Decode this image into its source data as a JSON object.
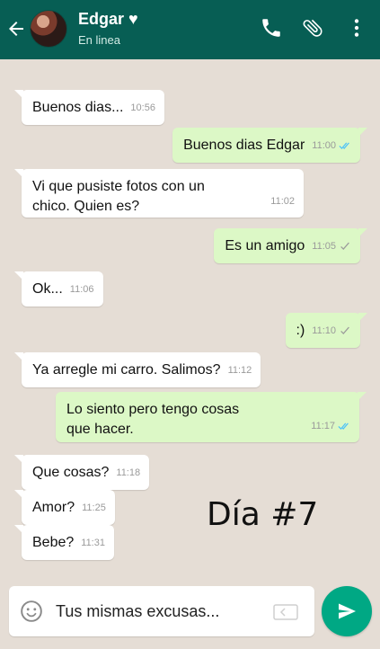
{
  "header": {
    "contact_name": "Edgar ♥",
    "status": "En linea"
  },
  "messages": [
    {
      "dir": "in",
      "text": "Buenos dias...",
      "time": "10:56",
      "tick": "none"
    },
    {
      "dir": "out",
      "text": "Buenos dias Edgar",
      "time": "11:00",
      "tick": "read"
    },
    {
      "dir": "in",
      "text": "Vi que pusiste fotos con un\nchico. Quien es?",
      "time": "11:02",
      "tick": "none"
    },
    {
      "dir": "out",
      "text": "Es un amigo",
      "time": "11:05",
      "tick": "sent"
    },
    {
      "dir": "in",
      "text": "Ok...",
      "time": "11:06",
      "tick": "none"
    },
    {
      "dir": "out",
      "text": ":)",
      "time": "11:10",
      "tick": "sent"
    },
    {
      "dir": "in",
      "text": "Ya arregle mi carro. Salimos?",
      "time": "11:12",
      "tick": "none"
    },
    {
      "dir": "out",
      "text": "Lo siento pero tengo cosas\nque hacer.",
      "time": "11:17",
      "tick": "read"
    },
    {
      "dir": "in",
      "text": "Que cosas?",
      "time": "11:18",
      "tick": "none"
    },
    {
      "dir": "in",
      "text": "Amor?",
      "time": "11:25",
      "tick": "none"
    },
    {
      "dir": "in",
      "text": "Bebe?",
      "time": "11:31",
      "tick": "none"
    }
  ],
  "overlay_text": "Día #7",
  "composer": {
    "value": "Tus mismas excusas..."
  },
  "colors": {
    "header": "#075e54",
    "background": "#e5ddd5",
    "incoming": "#ffffff",
    "outgoing": "#dcf8c6",
    "send_button": "#00a884",
    "read_tick": "#4fc3f7"
  },
  "icons": [
    "back-arrow-icon",
    "phone-icon",
    "paperclip-icon",
    "more-vert-icon",
    "emoji-icon",
    "gallery-icon",
    "send-icon"
  ]
}
